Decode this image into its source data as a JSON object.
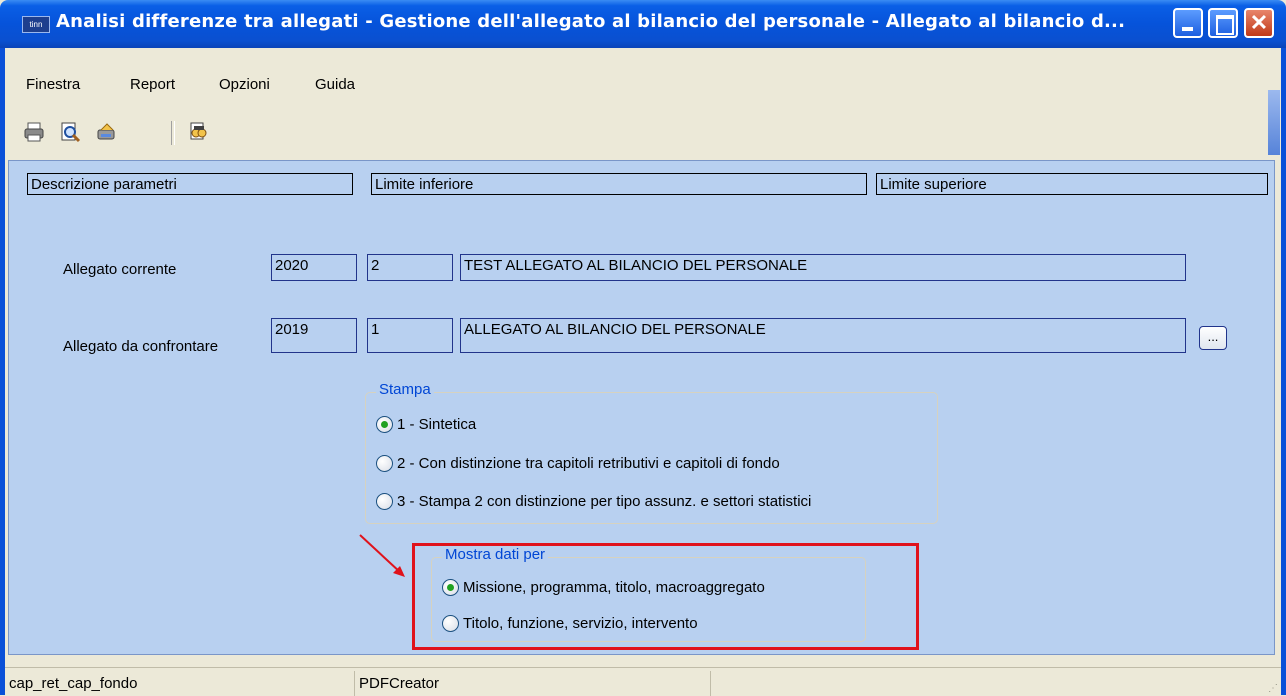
{
  "window": {
    "app_badge": "tinn",
    "title": "Analisi differenze tra allegati - Gestione dell'allegato al bilancio del personale - Allegato al bilancio d..."
  },
  "menu": [
    "Finestra",
    "Report",
    "Opzioni",
    "Guida"
  ],
  "toolbar": {
    "icons": [
      "printer-icon",
      "print-preview-icon",
      "export-icon",
      "search-icon"
    ]
  },
  "headers": {
    "col1": "Descrizione parametri",
    "col2": "Limite inferiore",
    "col3": "Limite superiore"
  },
  "allegato_corrente": {
    "label": "Allegato corrente",
    "anno": "2020",
    "numero": "2",
    "descrizione": "TEST ALLEGATO AL BILANCIO DEL PERSONALE"
  },
  "allegato_confronto": {
    "label": "Allegato da confrontare",
    "anno": "2019",
    "numero": "1",
    "descrizione": "ALLEGATO AL BILANCIO DEL PERSONALE",
    "browse_label": "..."
  },
  "stampa": {
    "legend": "Stampa",
    "options": [
      {
        "label": "1 - Sintetica",
        "selected": true
      },
      {
        "label": "2 - Con distinzione tra capitoli retributivi e capitoli di fondo",
        "selected": false
      },
      {
        "label": "3 - Stampa 2 con distinzione per tipo assunz. e settori statistici",
        "selected": false
      }
    ]
  },
  "mostra": {
    "legend": "Mostra dati per",
    "options": [
      {
        "label": "Missione, programma, titolo, macroaggregato",
        "selected": true
      },
      {
        "label": "Titolo, funzione, servizio, intervento",
        "selected": false
      }
    ]
  },
  "status": {
    "panel1": "cap_ret_cap_fondo",
    "panel2": "PDFCreator",
    "panel3": ""
  },
  "colors": {
    "title_bar": "#0A5FE6",
    "content_bg": "#B8D0F0",
    "highlight_box": "#E0121B",
    "legend_text": "#0046D5"
  }
}
